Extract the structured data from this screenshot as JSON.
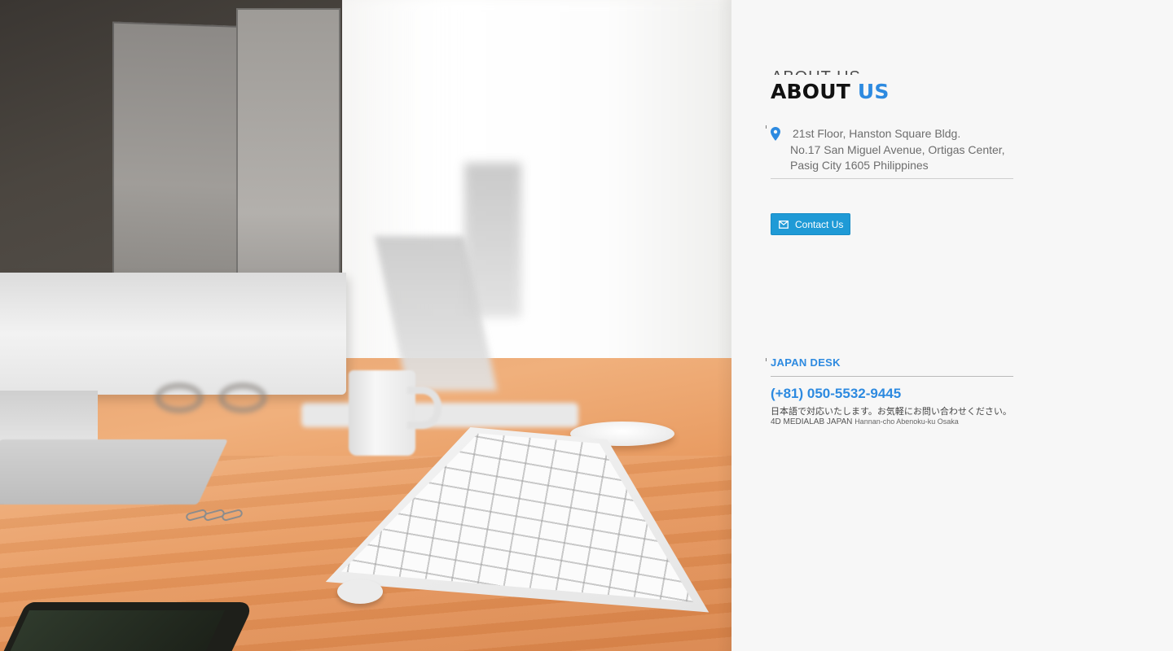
{
  "about": {
    "heading_main": "ABOUT",
    "heading_accent": "US",
    "heading_ghost": "ABOUT US",
    "address_line1": "21st Floor, Hanston Square Bldg.",
    "address_line2": "No.17 San Miguel Avenue, Ortigas Center,",
    "address_line3": "Pasig City 1605 Philippines",
    "contact_button": "Contact Us"
  },
  "japan_desk": {
    "title": "JAPAN DESK",
    "phone": "(+81) 050-5532-9445",
    "note": "日本語で対応いたします。お気軽にお問い合わせください。",
    "company": "4D MEDIALAB JAPAN",
    "company_address": "Hannan-cho Abenoku-ku Osaka"
  },
  "icons": {
    "address": "map-pin-icon",
    "contact": "envelope-icon"
  },
  "colors": {
    "accent": "#2d8ae0",
    "button": "#1f9ad6",
    "panel_bg": "#f7f7f7"
  }
}
